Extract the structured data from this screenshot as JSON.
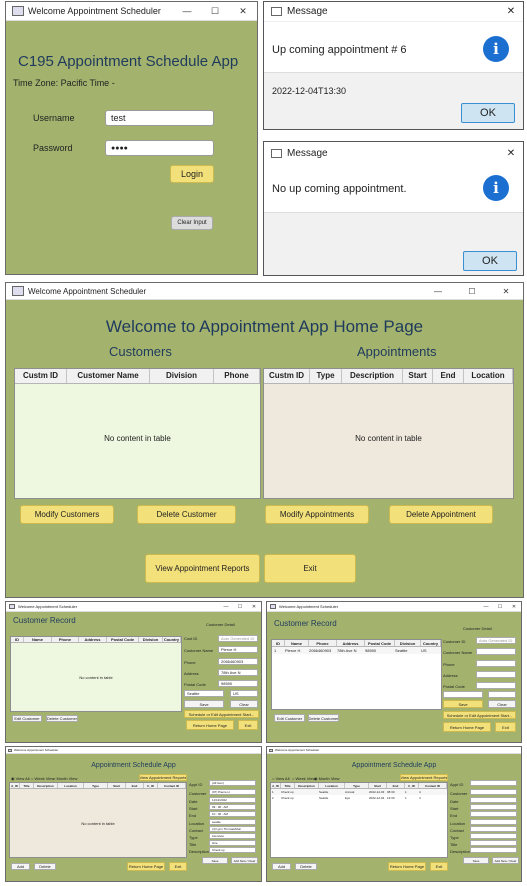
{
  "login": {
    "title": "Welcome Appointment Scheduler",
    "app_title": "C195 Appointment Schedule App",
    "timezone": "Time Zone: Pacific Time -",
    "username_label": "Username",
    "username_value": "test",
    "password_label": "Password",
    "password_value": "●●●●",
    "login_btn": "Login",
    "clear_btn": "Clear Input"
  },
  "message1": {
    "title": "Message",
    "text": "Up coming appointment # 6",
    "detail": "2022-12-04T13:30",
    "ok": "OK"
  },
  "message2": {
    "title": "Message",
    "text": "No up coming appointment.",
    "ok": "OK"
  },
  "home": {
    "title": "Welcome Appointment Scheduler",
    "heading": "Welcome to Appointment App Home Page",
    "customers_title": "Customers",
    "appointments_title": "Appointments",
    "customer_cols": [
      "Custm ID",
      "Customer Name",
      "Division",
      "Phone"
    ],
    "appointment_cols": [
      "Custm ID",
      "Type",
      "Description",
      "Start",
      "End",
      "Location"
    ],
    "empty": "No content in table",
    "btn_modify_customers": "Modify Customers",
    "btn_delete_customer": "Delete Customer",
    "btn_modify_appointments": "Modify Appointments",
    "btn_delete_appointment": "Delete Appointment",
    "btn_view_reports": "View Appointment Reports",
    "btn_exit": "Exit"
  },
  "cust1": {
    "title": "Welcome Appointment Scheduler",
    "heading": "Customer Record",
    "detail_title": "Customer Detail",
    "cols": [
      "ID",
      "Name",
      "Phone",
      "Address",
      "Postal Code",
      "Division",
      "Country"
    ],
    "empty": "No content in table",
    "labels": [
      "Cust ID",
      "Customer Name",
      "Phone",
      "Address",
      "Postal Code"
    ],
    "values": [
      "Auto Generated ID",
      "Pierce H",
      "2066460903",
      "78th Ave N",
      "98590"
    ],
    "division": "Seattle",
    "country": "US",
    "save": "Save",
    "clear": "Clear",
    "schedule": "Schedule or Edit Appointment Start...",
    "return": "Return Home Page",
    "exit": "Exit",
    "edit": "Edit Customer",
    "delete": "Delete Customer"
  },
  "cust2": {
    "title": "Welcome Appointment Scheduler",
    "heading": "Customer Record",
    "detail_title": "Customer Detail",
    "cols": [
      "ID",
      "Name",
      "Phone",
      "Address",
      "Postal Code",
      "Division",
      "Country"
    ],
    "row": [
      "1",
      "Pierce H",
      "2066460903",
      "78th Ave N",
      "98590",
      "Seattle",
      "US"
    ],
    "labels": [
      "Customer ID",
      "Customer Name",
      "Phone",
      "Address",
      "Postal Code"
    ],
    "values": [
      "Auto Generated ID",
      "",
      "",
      "",
      ""
    ],
    "save": "Save",
    "clear": "Clear",
    "schedule": "Schedule or Edit Appointment Start...",
    "return": "Return Home Page",
    "exit": "Exit",
    "edit": "Edit Customer",
    "delete": "Delete Customer"
  },
  "appt1": {
    "title": "Welcome Appointment Scheduler",
    "heading": "Appointment Schedule App",
    "radios": [
      "View All",
      "Week View",
      "Month View"
    ],
    "view_reports": "View Appointment Reports",
    "cols": [
      "A_ID",
      "Title",
      "Description",
      "Location",
      "Type",
      "Start",
      "End",
      "C_ID",
      "Contact ID"
    ],
    "empty": "No content in table",
    "labels": [
      "Appt ID",
      "Customer",
      "Date",
      "Start",
      "End",
      "Location",
      "Contact",
      "Type",
      "Title",
      "Description"
    ],
    "values": [
      "(All Gen)",
      "(97) Pierce H",
      "11/12/2022",
      "09 : 00 : AM",
      "10 : 00 : AM",
      "seattle",
      "(4) Lynn Thomas/Mun",
      "interview",
      "Hire",
      "Check up"
    ],
    "add": "Add",
    "delete": "Delete",
    "return": "Return Home Page",
    "exit": "Exit",
    "save": "Save",
    "add_new": "Add New / Clear"
  },
  "appt2": {
    "title": "Welcome Appointment Scheduler",
    "heading": "Appointment Schedule App",
    "radios": [
      "View All",
      "Week View",
      "Month View"
    ],
    "view_reports": "View Appointment Reports",
    "cols": [
      "A_ID",
      "Title",
      "Description",
      "Location",
      "Type",
      "Start",
      "End",
      "C_ID",
      "Contact ID"
    ],
    "rows": [
      [
        "1",
        "Check up",
        "Seattle",
        "Annual",
        "2022-12-03",
        "08:30",
        "1",
        "4"
      ],
      [
        "2",
        "Check up",
        "Seattle",
        "Eye",
        "2022-12-04",
        "13:30",
        "1",
        "4"
      ]
    ],
    "labels": [
      "Appt ID",
      "Customer",
      "Date",
      "Start",
      "End",
      "Location",
      "Contact",
      "Type",
      "Title",
      "Description"
    ],
    "add": "Add",
    "delete": "Delete",
    "return": "Return Home Page",
    "exit": "Exit",
    "save": "Save",
    "add_new": "Add New / Clear"
  }
}
